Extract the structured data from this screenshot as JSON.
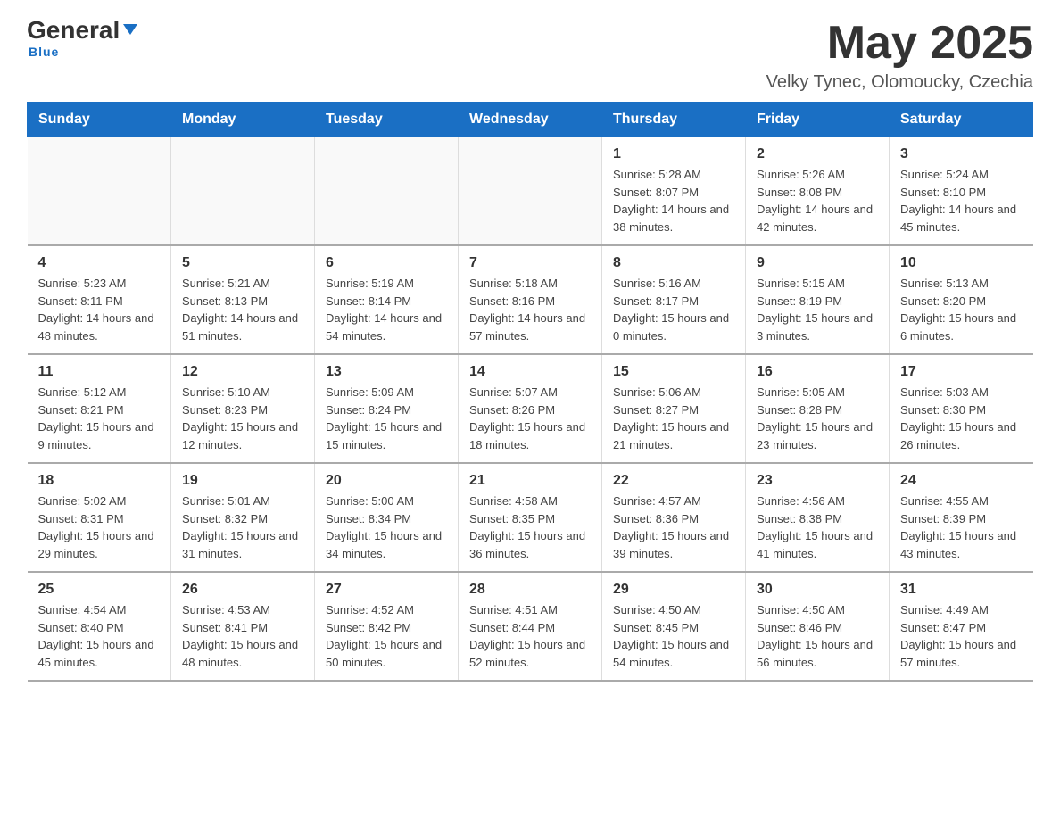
{
  "logo": {
    "general": "General",
    "triangle": "▼",
    "blue": "Blue"
  },
  "header": {
    "title": "May 2025",
    "subtitle": "Velky Tynec, Olomoucky, Czechia"
  },
  "weekdays": [
    "Sunday",
    "Monday",
    "Tuesday",
    "Wednesday",
    "Thursday",
    "Friday",
    "Saturday"
  ],
  "weeks": [
    [
      {
        "day": "",
        "info": ""
      },
      {
        "day": "",
        "info": ""
      },
      {
        "day": "",
        "info": ""
      },
      {
        "day": "",
        "info": ""
      },
      {
        "day": "1",
        "info": "Sunrise: 5:28 AM\nSunset: 8:07 PM\nDaylight: 14 hours and 38 minutes."
      },
      {
        "day": "2",
        "info": "Sunrise: 5:26 AM\nSunset: 8:08 PM\nDaylight: 14 hours and 42 minutes."
      },
      {
        "day": "3",
        "info": "Sunrise: 5:24 AM\nSunset: 8:10 PM\nDaylight: 14 hours and 45 minutes."
      }
    ],
    [
      {
        "day": "4",
        "info": "Sunrise: 5:23 AM\nSunset: 8:11 PM\nDaylight: 14 hours and 48 minutes."
      },
      {
        "day": "5",
        "info": "Sunrise: 5:21 AM\nSunset: 8:13 PM\nDaylight: 14 hours and 51 minutes."
      },
      {
        "day": "6",
        "info": "Sunrise: 5:19 AM\nSunset: 8:14 PM\nDaylight: 14 hours and 54 minutes."
      },
      {
        "day": "7",
        "info": "Sunrise: 5:18 AM\nSunset: 8:16 PM\nDaylight: 14 hours and 57 minutes."
      },
      {
        "day": "8",
        "info": "Sunrise: 5:16 AM\nSunset: 8:17 PM\nDaylight: 15 hours and 0 minutes."
      },
      {
        "day": "9",
        "info": "Sunrise: 5:15 AM\nSunset: 8:19 PM\nDaylight: 15 hours and 3 minutes."
      },
      {
        "day": "10",
        "info": "Sunrise: 5:13 AM\nSunset: 8:20 PM\nDaylight: 15 hours and 6 minutes."
      }
    ],
    [
      {
        "day": "11",
        "info": "Sunrise: 5:12 AM\nSunset: 8:21 PM\nDaylight: 15 hours and 9 minutes."
      },
      {
        "day": "12",
        "info": "Sunrise: 5:10 AM\nSunset: 8:23 PM\nDaylight: 15 hours and 12 minutes."
      },
      {
        "day": "13",
        "info": "Sunrise: 5:09 AM\nSunset: 8:24 PM\nDaylight: 15 hours and 15 minutes."
      },
      {
        "day": "14",
        "info": "Sunrise: 5:07 AM\nSunset: 8:26 PM\nDaylight: 15 hours and 18 minutes."
      },
      {
        "day": "15",
        "info": "Sunrise: 5:06 AM\nSunset: 8:27 PM\nDaylight: 15 hours and 21 minutes."
      },
      {
        "day": "16",
        "info": "Sunrise: 5:05 AM\nSunset: 8:28 PM\nDaylight: 15 hours and 23 minutes."
      },
      {
        "day": "17",
        "info": "Sunrise: 5:03 AM\nSunset: 8:30 PM\nDaylight: 15 hours and 26 minutes."
      }
    ],
    [
      {
        "day": "18",
        "info": "Sunrise: 5:02 AM\nSunset: 8:31 PM\nDaylight: 15 hours and 29 minutes."
      },
      {
        "day": "19",
        "info": "Sunrise: 5:01 AM\nSunset: 8:32 PM\nDaylight: 15 hours and 31 minutes."
      },
      {
        "day": "20",
        "info": "Sunrise: 5:00 AM\nSunset: 8:34 PM\nDaylight: 15 hours and 34 minutes."
      },
      {
        "day": "21",
        "info": "Sunrise: 4:58 AM\nSunset: 8:35 PM\nDaylight: 15 hours and 36 minutes."
      },
      {
        "day": "22",
        "info": "Sunrise: 4:57 AM\nSunset: 8:36 PM\nDaylight: 15 hours and 39 minutes."
      },
      {
        "day": "23",
        "info": "Sunrise: 4:56 AM\nSunset: 8:38 PM\nDaylight: 15 hours and 41 minutes."
      },
      {
        "day": "24",
        "info": "Sunrise: 4:55 AM\nSunset: 8:39 PM\nDaylight: 15 hours and 43 minutes."
      }
    ],
    [
      {
        "day": "25",
        "info": "Sunrise: 4:54 AM\nSunset: 8:40 PM\nDaylight: 15 hours and 45 minutes."
      },
      {
        "day": "26",
        "info": "Sunrise: 4:53 AM\nSunset: 8:41 PM\nDaylight: 15 hours and 48 minutes."
      },
      {
        "day": "27",
        "info": "Sunrise: 4:52 AM\nSunset: 8:42 PM\nDaylight: 15 hours and 50 minutes."
      },
      {
        "day": "28",
        "info": "Sunrise: 4:51 AM\nSunset: 8:44 PM\nDaylight: 15 hours and 52 minutes."
      },
      {
        "day": "29",
        "info": "Sunrise: 4:50 AM\nSunset: 8:45 PM\nDaylight: 15 hours and 54 minutes."
      },
      {
        "day": "30",
        "info": "Sunrise: 4:50 AM\nSunset: 8:46 PM\nDaylight: 15 hours and 56 minutes."
      },
      {
        "day": "31",
        "info": "Sunrise: 4:49 AM\nSunset: 8:47 PM\nDaylight: 15 hours and 57 minutes."
      }
    ]
  ]
}
